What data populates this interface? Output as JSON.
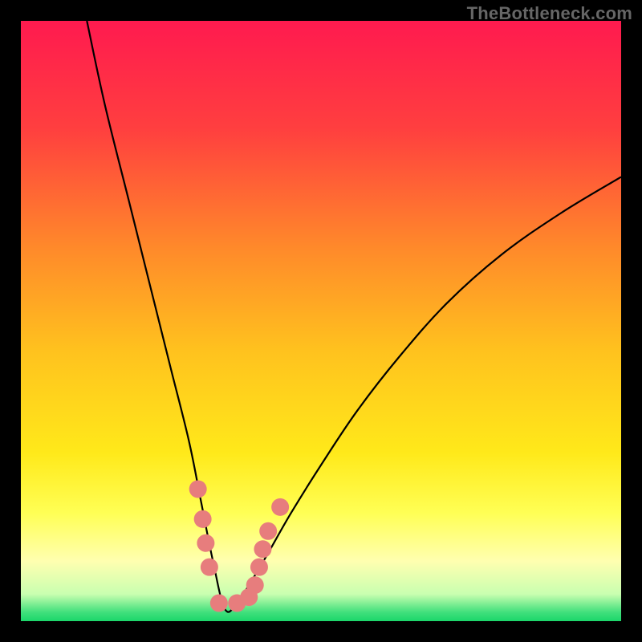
{
  "watermark": "TheBottleneck.com",
  "chart_data": {
    "type": "line",
    "title": "",
    "xlabel": "",
    "ylabel": "",
    "xlim": [
      0,
      100
    ],
    "ylim": [
      0,
      100
    ],
    "background_gradient": {
      "type": "linear",
      "direction": "vertical_top_to_bottom",
      "stops": [
        {
          "pos": 0.0,
          "color": "#ff1a4f"
        },
        {
          "pos": 0.18,
          "color": "#ff3f3f"
        },
        {
          "pos": 0.38,
          "color": "#ff8a2a"
        },
        {
          "pos": 0.55,
          "color": "#ffc21e"
        },
        {
          "pos": 0.72,
          "color": "#ffe91a"
        },
        {
          "pos": 0.82,
          "color": "#ffff55"
        },
        {
          "pos": 0.9,
          "color": "#ffffb0"
        },
        {
          "pos": 0.955,
          "color": "#c9ffb0"
        },
        {
          "pos": 0.985,
          "color": "#41e07c"
        },
        {
          "pos": 1.0,
          "color": "#1bd66a"
        }
      ]
    },
    "series": [
      {
        "name": "bottleneck-curve",
        "note": "V-shaped curve; left branch steep, right branch shallow; minimum near x≈34 at y≈2.",
        "x": [
          11,
          14,
          18,
          22,
          25,
          28,
          30,
          32,
          34,
          36,
          38,
          41,
          45,
          50,
          56,
          63,
          71,
          80,
          90,
          100
        ],
        "y": [
          100,
          86,
          70,
          54,
          42,
          30,
          20,
          10,
          2,
          3,
          6,
          11,
          18,
          26,
          35,
          44,
          53,
          61,
          68,
          74
        ]
      }
    ],
    "markers": {
      "name": "highlighted-points",
      "color": "#e77d7d",
      "points": [
        {
          "x": 29.5,
          "y": 22
        },
        {
          "x": 30.3,
          "y": 17
        },
        {
          "x": 30.8,
          "y": 13
        },
        {
          "x": 31.4,
          "y": 9
        },
        {
          "x": 33.0,
          "y": 3
        },
        {
          "x": 36.0,
          "y": 3
        },
        {
          "x": 38.0,
          "y": 4
        },
        {
          "x": 39.0,
          "y": 6
        },
        {
          "x": 39.7,
          "y": 9
        },
        {
          "x": 40.3,
          "y": 12
        },
        {
          "x": 41.2,
          "y": 15
        },
        {
          "x": 43.2,
          "y": 19
        }
      ]
    }
  }
}
